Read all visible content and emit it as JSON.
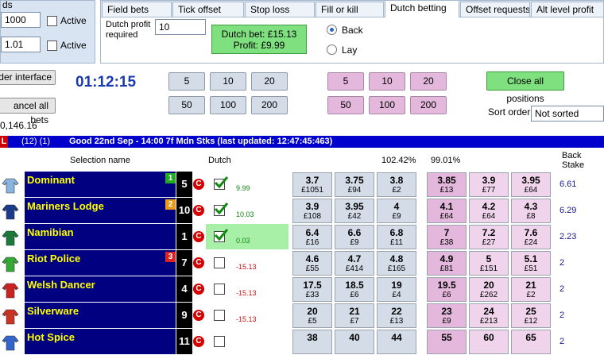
{
  "left_panel": {
    "title_fragment": "ds",
    "rows": [
      {
        "value": "1000",
        "label": "Active"
      },
      {
        "value": "1.01",
        "label": "Active"
      }
    ]
  },
  "tabs": [
    {
      "label": "Field bets",
      "active": false
    },
    {
      "label": "Tick offset",
      "active": false
    },
    {
      "label": "Stop loss",
      "active": false
    },
    {
      "label": "Fill or kill",
      "active": false
    },
    {
      "label": "Dutch betting",
      "active": true
    },
    {
      "label": "Offset requests",
      "active": false
    },
    {
      "label": "Alt level profit",
      "active": false
    }
  ],
  "dutch_tab": {
    "profit_label": "Dutch profit required",
    "profit_value": "10",
    "bet_line": "Dutch bet: £15.13",
    "profit_line": "Profit: £9.99",
    "back_label": "Back",
    "lay_label": "Lay"
  },
  "controls": {
    "order_interface_label": "der interface",
    "cancel_all_label": "ancel all bets",
    "timer": "01:12:15",
    "balance": "0,146.16",
    "back_stakes": [
      "5",
      "10",
      "20",
      "50",
      "100",
      "200"
    ],
    "lay_stakes": [
      "5",
      "10",
      "20",
      "50",
      "100",
      "200"
    ],
    "close_all_label": "Close all positions",
    "sort_label": "Sort order",
    "sort_value": "Not sorted"
  },
  "market": {
    "prefix": "L",
    "counts": "(12)  (1)",
    "title": "Good 22nd Sep - 14:00 7f Mdn Stks (last updated: 12:47:45:463)"
  },
  "columns": {
    "selection": "Selection name",
    "dutch": "Dutch",
    "back_pct": "102.42%",
    "lay_pct": "99.01%",
    "back_stake": "Back Stake"
  },
  "runners": [
    {
      "name": "Dominant",
      "badge": "1",
      "badge_color": "#22aa22",
      "num": "5",
      "checked": true,
      "dutch": "9.99",
      "dutch_color": "#118811",
      "back": [
        [
          "3.7",
          "£1051"
        ],
        [
          "3.75",
          "£94"
        ],
        [
          "3.8",
          "£2"
        ]
      ],
      "lay": [
        [
          "3.85",
          "£13"
        ],
        [
          "3.9",
          "£77"
        ],
        [
          "3.95",
          "£64"
        ]
      ],
      "stake": "6.61",
      "silk": "#8ab4e0"
    },
    {
      "name": "Mariners Lodge",
      "badge": "2",
      "badge_color": "#e89a1a",
      "num": "10",
      "checked": true,
      "dutch": "10.03",
      "dutch_color": "#118811",
      "back": [
        [
          "3.9",
          "£108"
        ],
        [
          "3.95",
          "£42"
        ],
        [
          "4",
          "£9"
        ]
      ],
      "lay": [
        [
          "4.1",
          "£64"
        ],
        [
          "4.2",
          "£64"
        ],
        [
          "4.3",
          "£8"
        ]
      ],
      "stake": "6.29",
      "silk": "#1a3a8c"
    },
    {
      "name": "Namibian",
      "badge": "",
      "badge_color": "",
      "num": "1",
      "checked": true,
      "dutch": "0.03",
      "dutch_color": "#118811",
      "back": [
        [
          "6.4",
          "£16"
        ],
        [
          "6.6",
          "£9"
        ],
        [
          "6.8",
          "£11"
        ]
      ],
      "lay": [
        [
          "7",
          "£38"
        ],
        [
          "7.2",
          "£27"
        ],
        [
          "7.6",
          "£24"
        ]
      ],
      "stake": "2.23",
      "silk": "#1a7a3a"
    },
    {
      "name": "Riot Police",
      "badge": "3",
      "badge_color": "#dd2222",
      "num": "7",
      "checked": false,
      "dutch": "-15.13",
      "dutch_color": "#cc1111",
      "back": [
        [
          "4.6",
          "£55"
        ],
        [
          "4.7",
          "£414"
        ],
        [
          "4.8",
          "£165"
        ]
      ],
      "lay": [
        [
          "4.9",
          "£81"
        ],
        [
          "5",
          "£151"
        ],
        [
          "5.1",
          "£51"
        ]
      ],
      "stake": "2",
      "silk": "#33aa33"
    },
    {
      "name": "Welsh Dancer",
      "badge": "",
      "badge_color": "",
      "num": "4",
      "checked": false,
      "dutch": "-15.13",
      "dutch_color": "#cc1111",
      "back": [
        [
          "17.5",
          "£33"
        ],
        [
          "18.5",
          "£6"
        ],
        [
          "19",
          "£4"
        ]
      ],
      "lay": [
        [
          "19.5",
          "£6"
        ],
        [
          "20",
          "£262"
        ],
        [
          "21",
          "£2"
        ]
      ],
      "stake": "2",
      "silk": "#cc2222"
    },
    {
      "name": "Silverware",
      "badge": "",
      "badge_color": "",
      "num": "9",
      "checked": false,
      "dutch": "-15.13",
      "dutch_color": "#cc1111",
      "back": [
        [
          "20",
          "£5"
        ],
        [
          "21",
          "£7"
        ],
        [
          "22",
          "£13"
        ]
      ],
      "lay": [
        [
          "23",
          "£9"
        ],
        [
          "24",
          "£213"
        ],
        [
          "25",
          "£12"
        ]
      ],
      "stake": "2",
      "silk": "#cc3322"
    },
    {
      "name": "Hot Spice",
      "badge": "",
      "badge_color": "",
      "num": "11",
      "checked": false,
      "dutch": "",
      "dutch_color": "#cc1111",
      "back": [
        [
          "38",
          ""
        ],
        [
          "40",
          ""
        ],
        [
          "44",
          ""
        ]
      ],
      "lay": [
        [
          "55",
          ""
        ],
        [
          "60",
          ""
        ],
        [
          "65",
          ""
        ]
      ],
      "stake": "2",
      "silk": "#3366cc"
    }
  ]
}
